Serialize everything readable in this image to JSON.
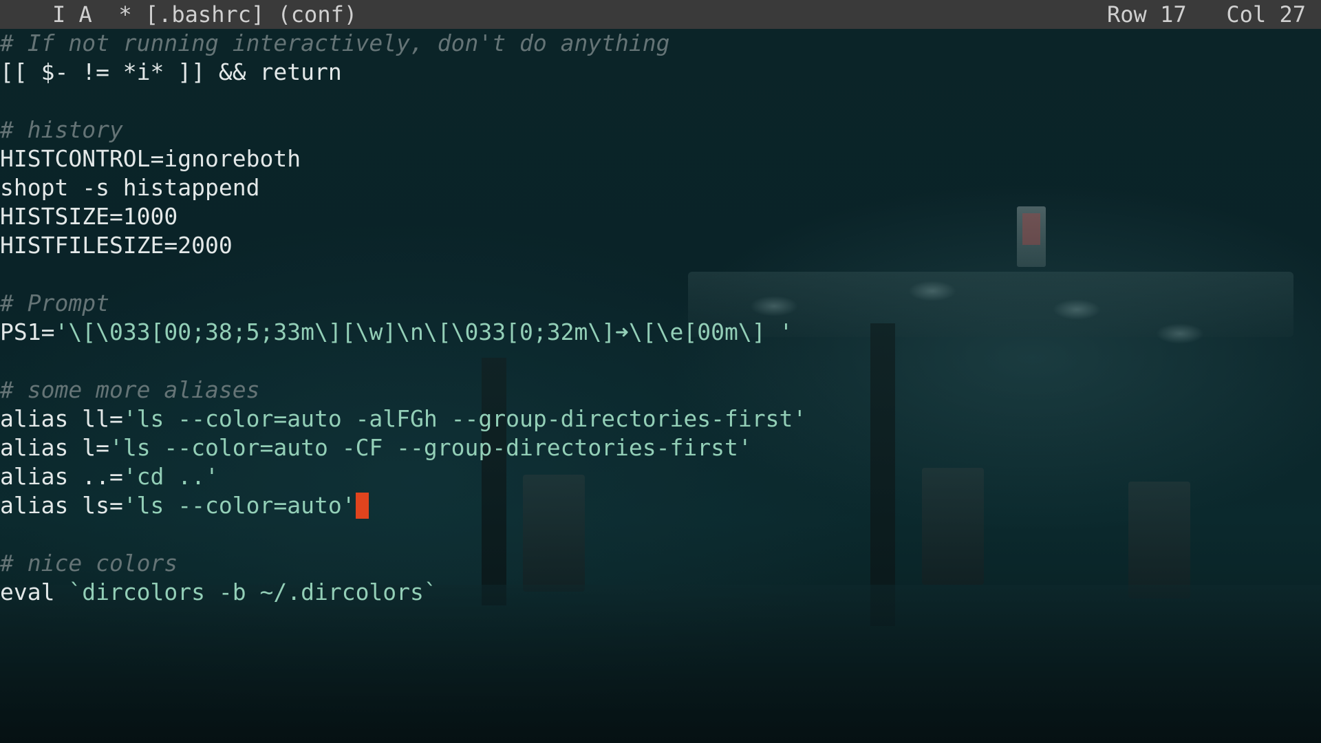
{
  "statusbar": {
    "mode": "I A",
    "file": "* [.bashrc] (conf)",
    "row": "Row 17",
    "col": "Col 27"
  },
  "editor": {
    "lines": [
      {
        "t": "comment",
        "text": "# If not running interactively, don't do anything"
      },
      {
        "t": "plain",
        "text": "[[ $- != *i* ]] && return"
      },
      {
        "t": "blank",
        "text": ""
      },
      {
        "t": "comment",
        "text": "# history"
      },
      {
        "t": "plain",
        "text": "HISTCONTROL=ignoreboth"
      },
      {
        "t": "plain",
        "text": "shopt -s histappend"
      },
      {
        "t": "plain",
        "text": "HISTSIZE=1000"
      },
      {
        "t": "plain",
        "text": "HISTFILESIZE=2000"
      },
      {
        "t": "blank",
        "text": ""
      },
      {
        "t": "comment",
        "text": "# Prompt"
      },
      {
        "t": "mixed",
        "a": "PS1=",
        "b": "'\\[\\033[00;38;5;33m\\][\\w]\\n\\[\\033[0;32m\\]➜\\[\\e[00m\\] '"
      },
      {
        "t": "blank",
        "text": ""
      },
      {
        "t": "comment",
        "text": "# some more aliases"
      },
      {
        "t": "mixed",
        "a": "alias ll=",
        "b": "'ls --color=auto -alFGh --group-directories-first'"
      },
      {
        "t": "mixed",
        "a": "alias l=",
        "b": "'ls --color=auto -CF --group-directories-first'"
      },
      {
        "t": "mixed",
        "a": "alias ..=",
        "b": "'cd ..'"
      },
      {
        "t": "mixed",
        "a": "alias ls=",
        "b": "'ls --color=auto'",
        "cursor": true
      },
      {
        "t": "blank",
        "text": ""
      },
      {
        "t": "comment",
        "text": "# nice colors"
      },
      {
        "t": "mixed",
        "a": "eval ",
        "b": "`dircolors -b ~/.dircolors`"
      }
    ]
  },
  "colors": {
    "cursor": "#e0441e",
    "comment": "#657476",
    "string": "#93cfb7",
    "statusbar_bg": "#3a3a3a"
  }
}
